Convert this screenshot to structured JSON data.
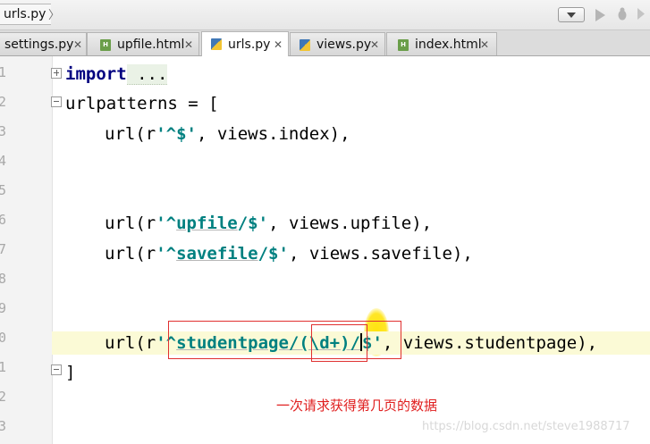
{
  "nav": {
    "breadcrumb": "urls.py"
  },
  "tabs": [
    {
      "label": "settings.py",
      "type": "py",
      "active": false
    },
    {
      "label": "upfile.html",
      "type": "html",
      "active": false
    },
    {
      "label": "urls.py",
      "type": "py",
      "active": true
    },
    {
      "label": "views.py",
      "type": "py",
      "active": false
    },
    {
      "label": "index.html",
      "type": "html",
      "active": false
    }
  ],
  "gutter": {
    "line_numbers": [
      "1",
      "2",
      "3",
      "4",
      "5",
      "6",
      "7",
      "8",
      "9",
      "0",
      "1",
      "2",
      "3"
    ]
  },
  "code": {
    "l1_kw": "import",
    "l1_folded": " ...",
    "l2": "urlpatterns = [",
    "l3_pre": "url(r",
    "l3_str": "'^$'",
    "l3_post": ", views.index),",
    "l4_pre": "url(r",
    "l4_str_a": "'^",
    "l4_str_b": "upfile",
    "l4_str_c": "/$'",
    "l4_post": ", views.upfile),",
    "l5_pre": "url(r",
    "l5_str_a": "'^",
    "l5_str_b": "savefile",
    "l5_str_c": "/$'",
    "l5_post": ", views.savefile),",
    "l6_pre": "url(r",
    "l6_str_a": "'^",
    "l6_str_b": "studentpage/(\\d+)/",
    "l6_str_c": "$'",
    "l6_post": ", views.studentpage),",
    "l7": "]"
  },
  "annotation": {
    "note": "一次请求获得第几页的数据",
    "color": "#e02020"
  },
  "watermark": "https://blog.csdn.net/steve1988717"
}
